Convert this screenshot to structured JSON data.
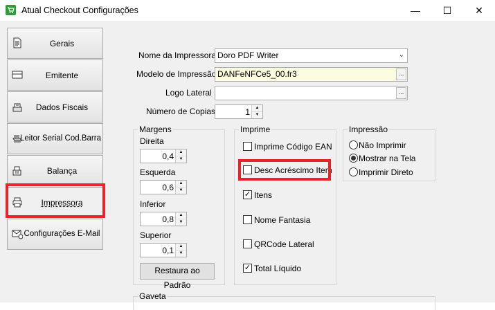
{
  "window": {
    "title": "Atual Checkout Configurações",
    "minimize_glyph": "—",
    "maximize_glyph": "☐",
    "close_glyph": "✕"
  },
  "sidebar": {
    "items": [
      {
        "label": "Gerais",
        "icon": "document-icon"
      },
      {
        "label": "Emitente",
        "icon": "card-icon"
      },
      {
        "label": "Dados Fiscais",
        "icon": "scale-icon"
      },
      {
        "label": "Leitor Serial Cod.Barra",
        "icon": "barcode-scanner-icon"
      },
      {
        "label": "Balança",
        "icon": "balance-icon"
      },
      {
        "label": "Impressora",
        "icon": "printer-icon"
      },
      {
        "label": "Configurações E-Mail",
        "icon": "email-settings-icon"
      }
    ],
    "active_index": 5
  },
  "form": {
    "printer_name_label": "Nome da Impressora",
    "printer_name_value": "Doro PDF Writer",
    "print_model_label": "Modelo de Impressão",
    "print_model_value": "DANFeNFCe5_00.fr3",
    "side_logo_label": "Logo Lateral",
    "side_logo_value": "",
    "copies_label": "Número de Copias",
    "copies_value": "1",
    "ellipsis": "..."
  },
  "margins": {
    "title": "Margens",
    "right_label": "Direita",
    "right_value": "0,4",
    "left_label": "Esquerda",
    "left_value": "0,6",
    "bottom_label": "Inferior",
    "bottom_value": "0,8",
    "top_label": "Superior",
    "top_value": "0,1",
    "restore_button": "Restaura ao Padrão"
  },
  "prints": {
    "title": "Imprime",
    "items": [
      {
        "label": "Imprime Código EAN",
        "checked": false
      },
      {
        "label": "Desc Acréscimo Item",
        "checked": false
      },
      {
        "label": "Itens",
        "checked": true
      },
      {
        "label": "Nome Fantasia",
        "checked": false
      },
      {
        "label": "QRCode Lateral",
        "checked": false
      },
      {
        "label": "Total Líquido",
        "checked": true
      }
    ]
  },
  "impression": {
    "title": "Impressão",
    "options": [
      {
        "label": "Não Imprimir",
        "selected": false
      },
      {
        "label": "Mostrar na Tela",
        "selected": true
      },
      {
        "label": "Imprimir Direto",
        "selected": false
      }
    ]
  },
  "drawer": {
    "title": "Gaveta"
  },
  "highlight_color": "#e8232a"
}
